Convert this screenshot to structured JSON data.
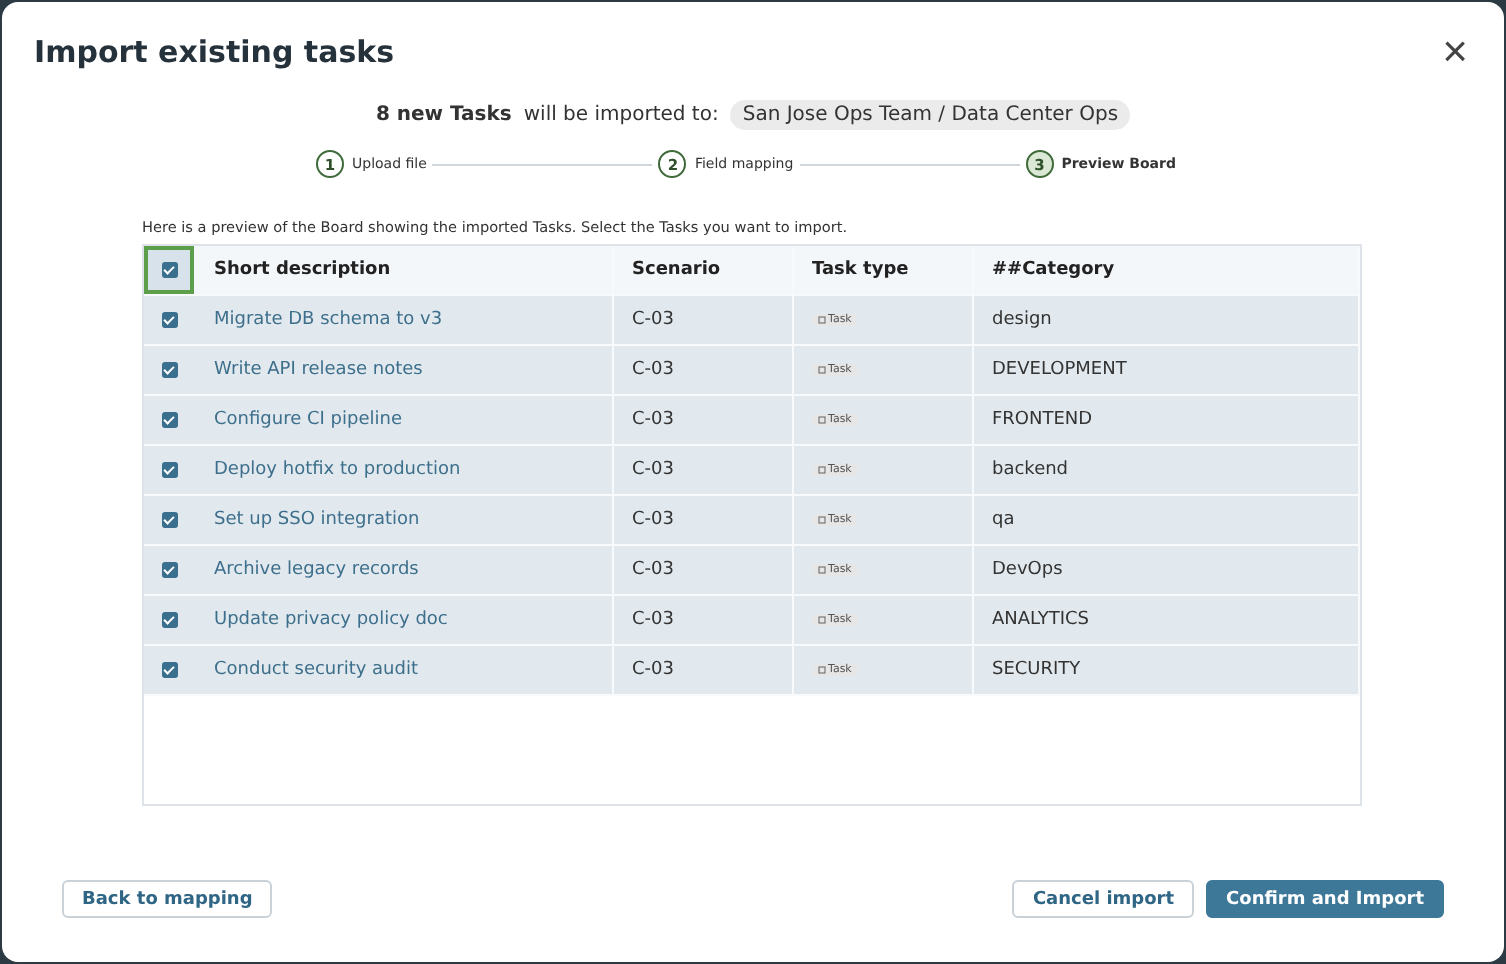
{
  "dialog": {
    "title": "Import existing tasks",
    "close": "×"
  },
  "summary": {
    "count": "8 new Tasks",
    "text": "will be imported to:",
    "target": "San Jose Ops Team / Data Center Ops"
  },
  "steps": [
    {
      "number": "1",
      "label": "Upload file",
      "selected": false
    },
    {
      "number": "2",
      "label": "Field mapping",
      "selected": false
    },
    {
      "number": "3",
      "label": "Preview Board",
      "selected": true
    }
  ],
  "hint": "Here is a preview of the Board showing the imported Tasks. Select the Tasks you want to import.",
  "table": {
    "select_all": {
      "checked": true
    },
    "columns": [
      "Short description",
      "Scenario",
      "Task type",
      "##Category"
    ],
    "rows": [
      {
        "checked": true,
        "description": "Migrate DB schema to v3",
        "scenario": "C-03",
        "type": "Task",
        "category": "design"
      },
      {
        "checked": true,
        "description": "Write API release notes",
        "scenario": "C-03",
        "type": "Task",
        "category": "DEVELOPMENT"
      },
      {
        "checked": true,
        "description": "Configure CI pipeline",
        "scenario": "C-03",
        "type": "Task",
        "category": "FRONTEND"
      },
      {
        "checked": true,
        "description": "Deploy hotfix to production",
        "scenario": "C-03",
        "type": "Task",
        "category": "backend"
      },
      {
        "checked": true,
        "description": "Set up SSO integration",
        "scenario": "C-03",
        "type": "Task",
        "category": "qa"
      },
      {
        "checked": true,
        "description": "Archive legacy records",
        "scenario": "C-03",
        "type": "Task",
        "category": "DevOps"
      },
      {
        "checked": true,
        "description": "Update privacy policy doc",
        "scenario": "C-03",
        "type": "Task",
        "category": "ANALYTICS"
      },
      {
        "checked": true,
        "description": "Conduct security audit",
        "scenario": "C-03",
        "type": "Task",
        "category": "SECURITY"
      }
    ]
  },
  "buttons": {
    "back": "Back to mapping",
    "cancel": "Cancel import",
    "confirm": "Confirm and Import"
  }
}
